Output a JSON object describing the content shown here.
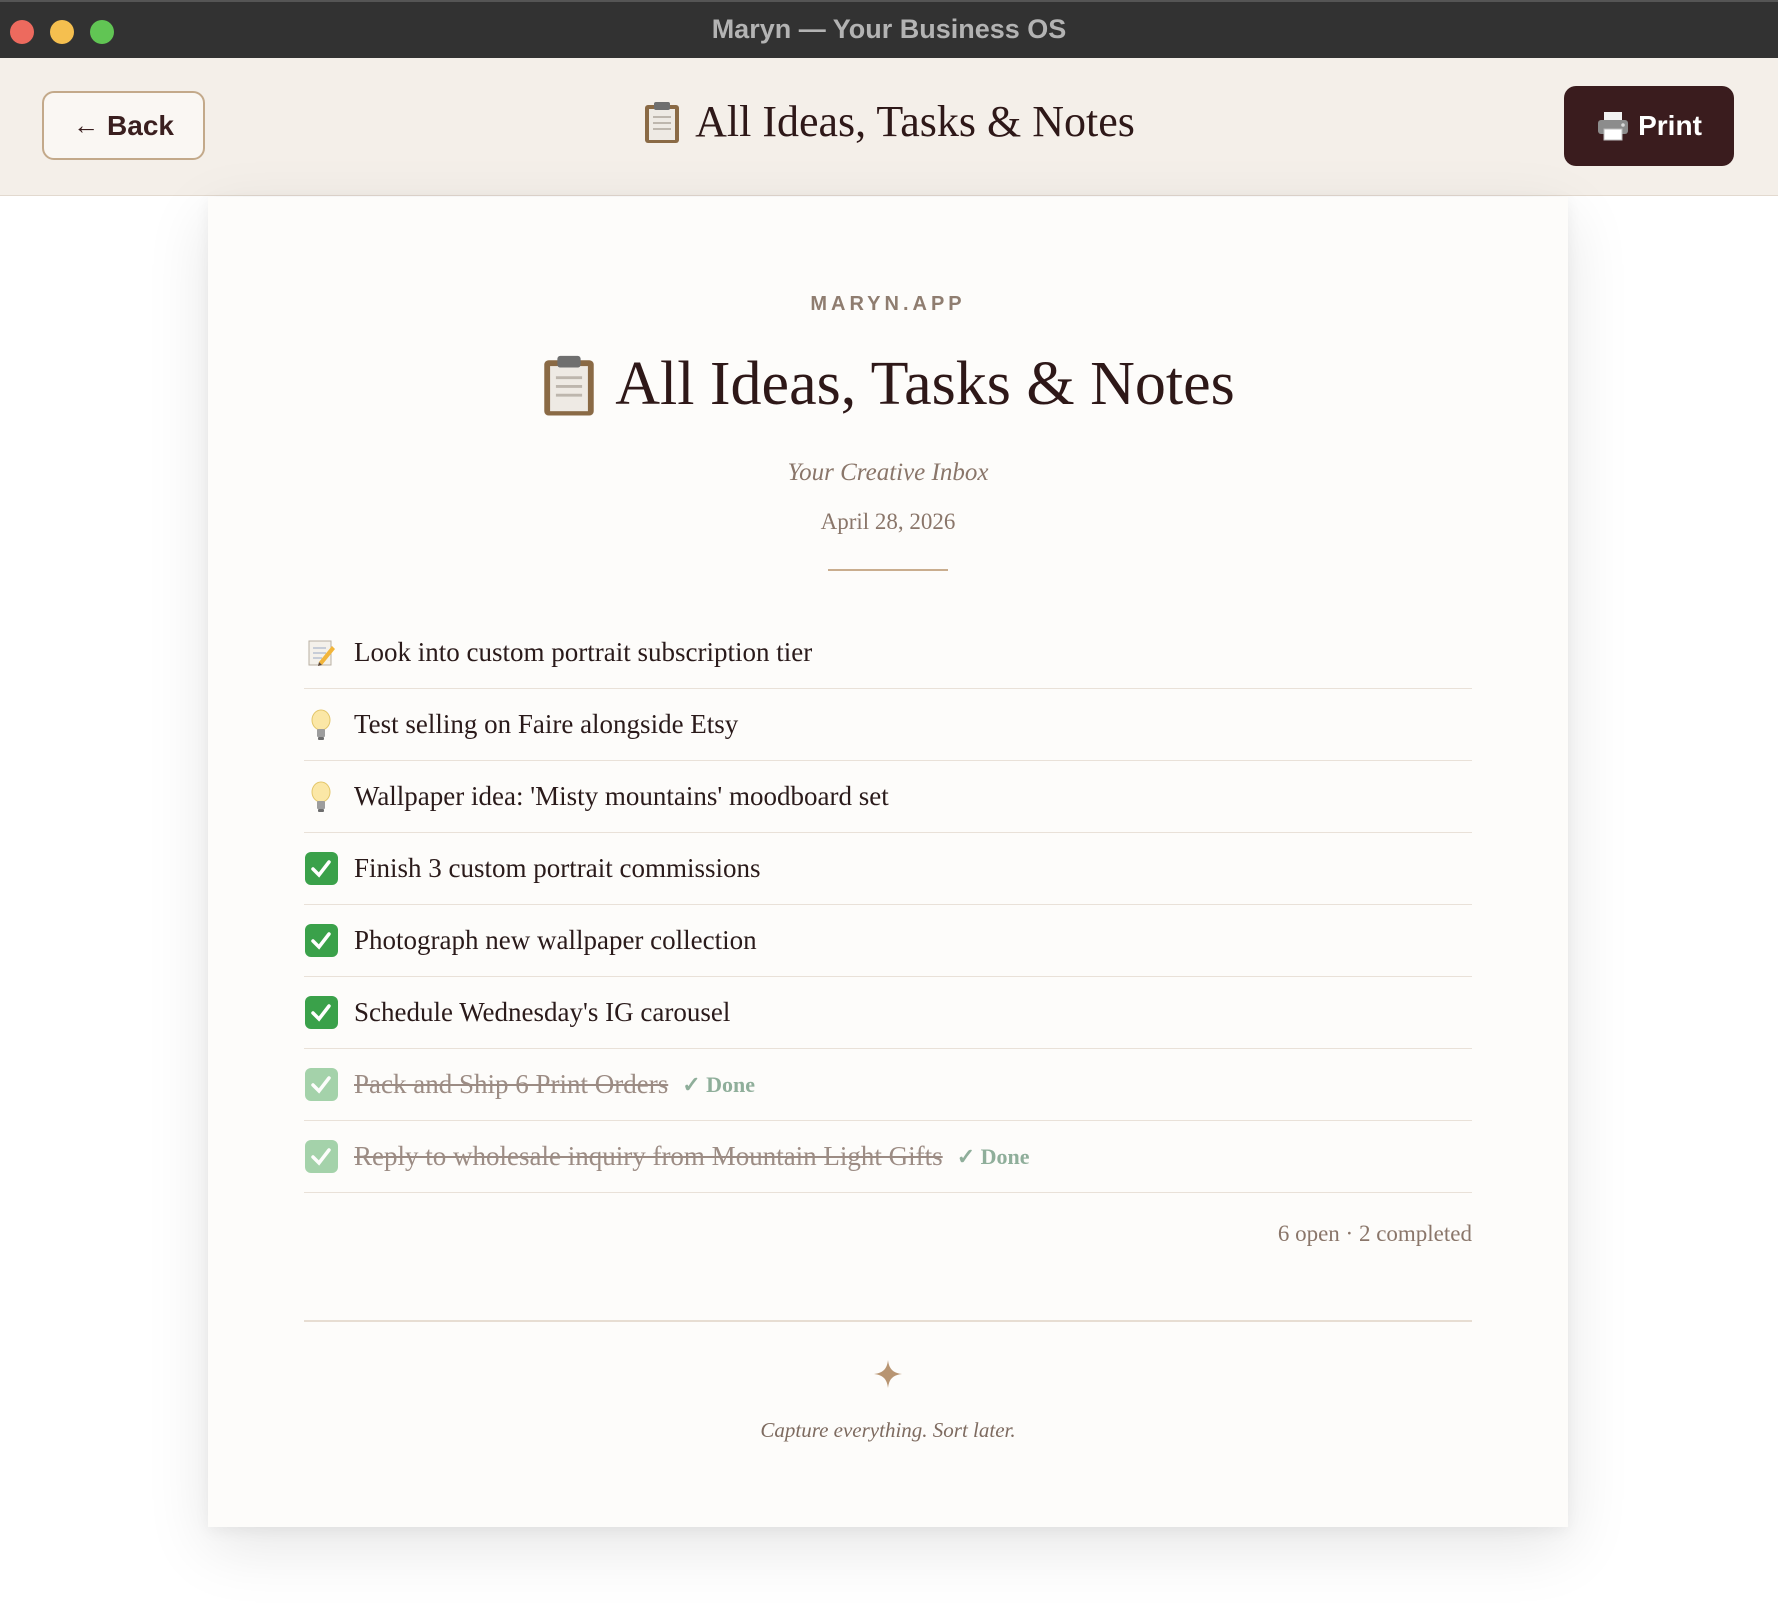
{
  "window": {
    "title": "Maryn — Your Business OS"
  },
  "header": {
    "back_label": "Back",
    "title": "All Ideas, Tasks & Notes",
    "print_label": "Print"
  },
  "paper": {
    "brand": "MARYN.APP",
    "title": "All Ideas, Tasks & Notes",
    "subtitle": "Your Creative Inbox",
    "date": "April 28, 2026",
    "items": [
      {
        "icon": "memo-icon",
        "text": "Look into custom portrait subscription tier",
        "done": false
      },
      {
        "icon": "lightbulb-icon",
        "text": "Test selling on Faire alongside Etsy",
        "done": false
      },
      {
        "icon": "lightbulb-icon",
        "text": "Wallpaper idea: 'Misty mountains' moodboard set",
        "done": false
      },
      {
        "icon": "check-box-icon",
        "text": "Finish 3 custom portrait commissions",
        "done": false
      },
      {
        "icon": "check-box-icon",
        "text": "Photograph new wallpaper collection",
        "done": false
      },
      {
        "icon": "check-box-icon",
        "text": "Schedule Wednesday's IG carousel",
        "done": false
      },
      {
        "icon": "check-box-icon",
        "text": "Pack and Ship 6 Print Orders",
        "done": true,
        "tag": "✓ Done"
      },
      {
        "icon": "check-box-icon",
        "text": "Reply to wholesale inquiry from Mountain Light Gifts",
        "done": true,
        "tag": "✓ Done"
      }
    ],
    "summary": "6 open · 2 completed",
    "footer_tagline": "Capture everything. Sort later."
  },
  "colors": {
    "accent_dark": "#3a1c1e",
    "header_bg": "#f4efe9",
    "done_green": "#8fae9a",
    "check_green": "#3aa14a"
  }
}
